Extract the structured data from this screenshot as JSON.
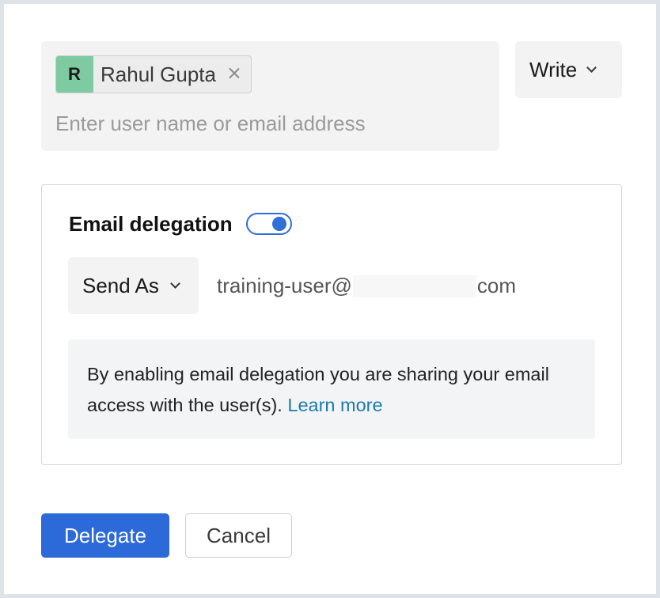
{
  "recipients": {
    "chips": [
      {
        "avatar_initial": "R",
        "name": "Rahul Gupta"
      }
    ],
    "input_placeholder": "Enter user name or email address"
  },
  "permission": {
    "selected": "Write"
  },
  "delegation": {
    "title": "Email delegation",
    "enabled": true,
    "send_mode": "Send As",
    "email_prefix": "training-user@",
    "email_suffix": "com",
    "info_text": "By enabling email delegation you are sharing your email access with the user(s).",
    "learn_more": "Learn more"
  },
  "actions": {
    "primary": "Delegate",
    "secondary": "Cancel"
  },
  "colors": {
    "accent": "#2b6ad8",
    "avatar": "#7ecba1",
    "link": "#1a7bb0"
  }
}
